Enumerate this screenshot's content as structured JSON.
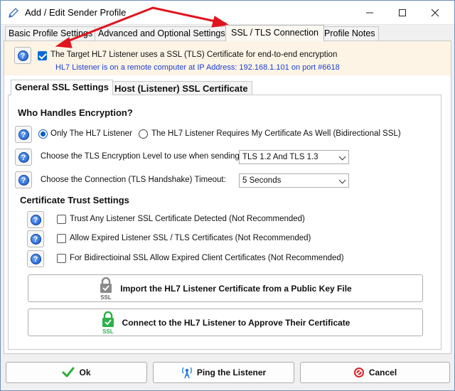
{
  "window": {
    "title": "Add / Edit Sender Profile"
  },
  "tabs": [
    {
      "label": "Basic Profile Settings"
    },
    {
      "label": "Advanced and Optional Settings"
    },
    {
      "label": "SSL / TLS Connection"
    },
    {
      "label": "Profile Notes"
    }
  ],
  "banner": {
    "checkbox_label": "The Target HL7 Listener uses a SSL (TLS) Certificate for end-to-end encryption",
    "checked": true,
    "info": "HL7 Listener is on a remote computer at IP Address: 192.168.1.101 on port #6618"
  },
  "inner_tabs": [
    {
      "label": "General SSL Settings"
    },
    {
      "label": "Host (Listener) SSL Certificate"
    }
  ],
  "encryption": {
    "heading": "Who Handles Encryption?",
    "option_only": "Only The HL7 Listener",
    "option_both": "The HL7 Listener Requires My Certificate As Well (Bidirectional SSL)",
    "tls_label": "Choose the TLS Encryption Level to use when sending:",
    "tls_value": "TLS 1.2 And TLS 1.3",
    "timeout_label": "Choose the Connection (TLS Handshake) Timeout:",
    "timeout_value": "5 Seconds"
  },
  "trust": {
    "heading": "Certificate Trust Settings",
    "options": [
      {
        "label": "Trust Any Listener SSL Certificate Detected (Not Recommended)",
        "checked": false
      },
      {
        "label": "Allow Expired Listener SSL / TLS Certificates (Not Recommended)",
        "checked": false
      },
      {
        "label": "For Bidirectioinal SSL Allow Expired Client Certificates (Not Recommended)",
        "checked": false
      }
    ]
  },
  "actions": {
    "import_label": "Import the HL7 Listener Certificate from a Public Key File",
    "connect_label": "Connect to the HL7 Listener to Approve Their Certificate",
    "lock_text": "SSL"
  },
  "footer": {
    "ok": "Ok",
    "ping": "Ping the Listener",
    "cancel": "Cancel"
  },
  "colors": {
    "annotation_arrow": "#e0141e",
    "banner_bg": "#fdf4e6",
    "link_text": "#1a3fd0",
    "lock_gray": "#8a8a8a",
    "lock_green": "#2db14a"
  }
}
